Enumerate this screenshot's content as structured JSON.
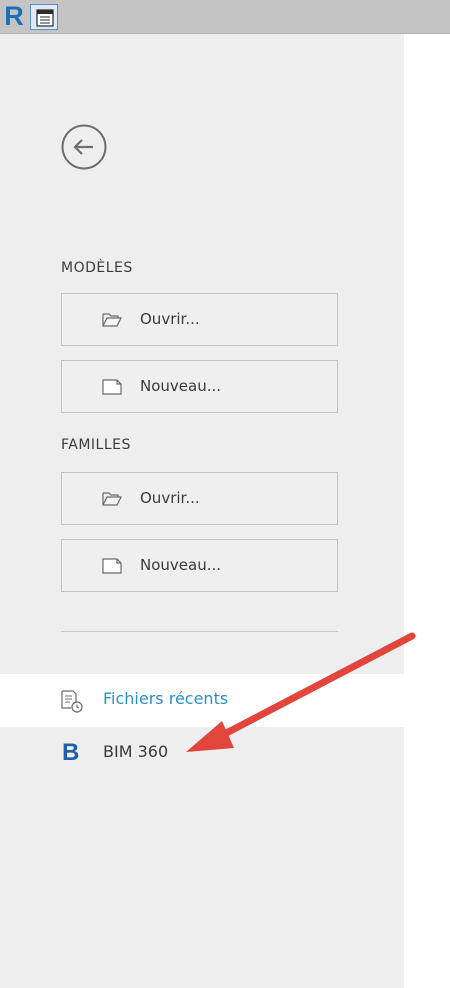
{
  "toolbar": {
    "app_logo": "R",
    "view_icon": "properties-icon"
  },
  "sidebar": {
    "back_icon": "back-arrow-icon",
    "models": {
      "title": "MODÈLES",
      "open_label": "Ouvrir...",
      "new_label": "Nouveau..."
    },
    "families": {
      "title": "FAMILLES",
      "open_label": "Ouvrir...",
      "new_label": "Nouveau..."
    },
    "nav": [
      {
        "label": "Fichiers récents",
        "icon": "recent-files-icon",
        "active": true
      },
      {
        "label": "BIM 360",
        "icon": "bim360-icon",
        "active": false
      }
    ]
  },
  "colors": {
    "accent": "#2a8fc3",
    "sidebar_bg": "#eeeeee",
    "annotation": "#e2453c"
  }
}
